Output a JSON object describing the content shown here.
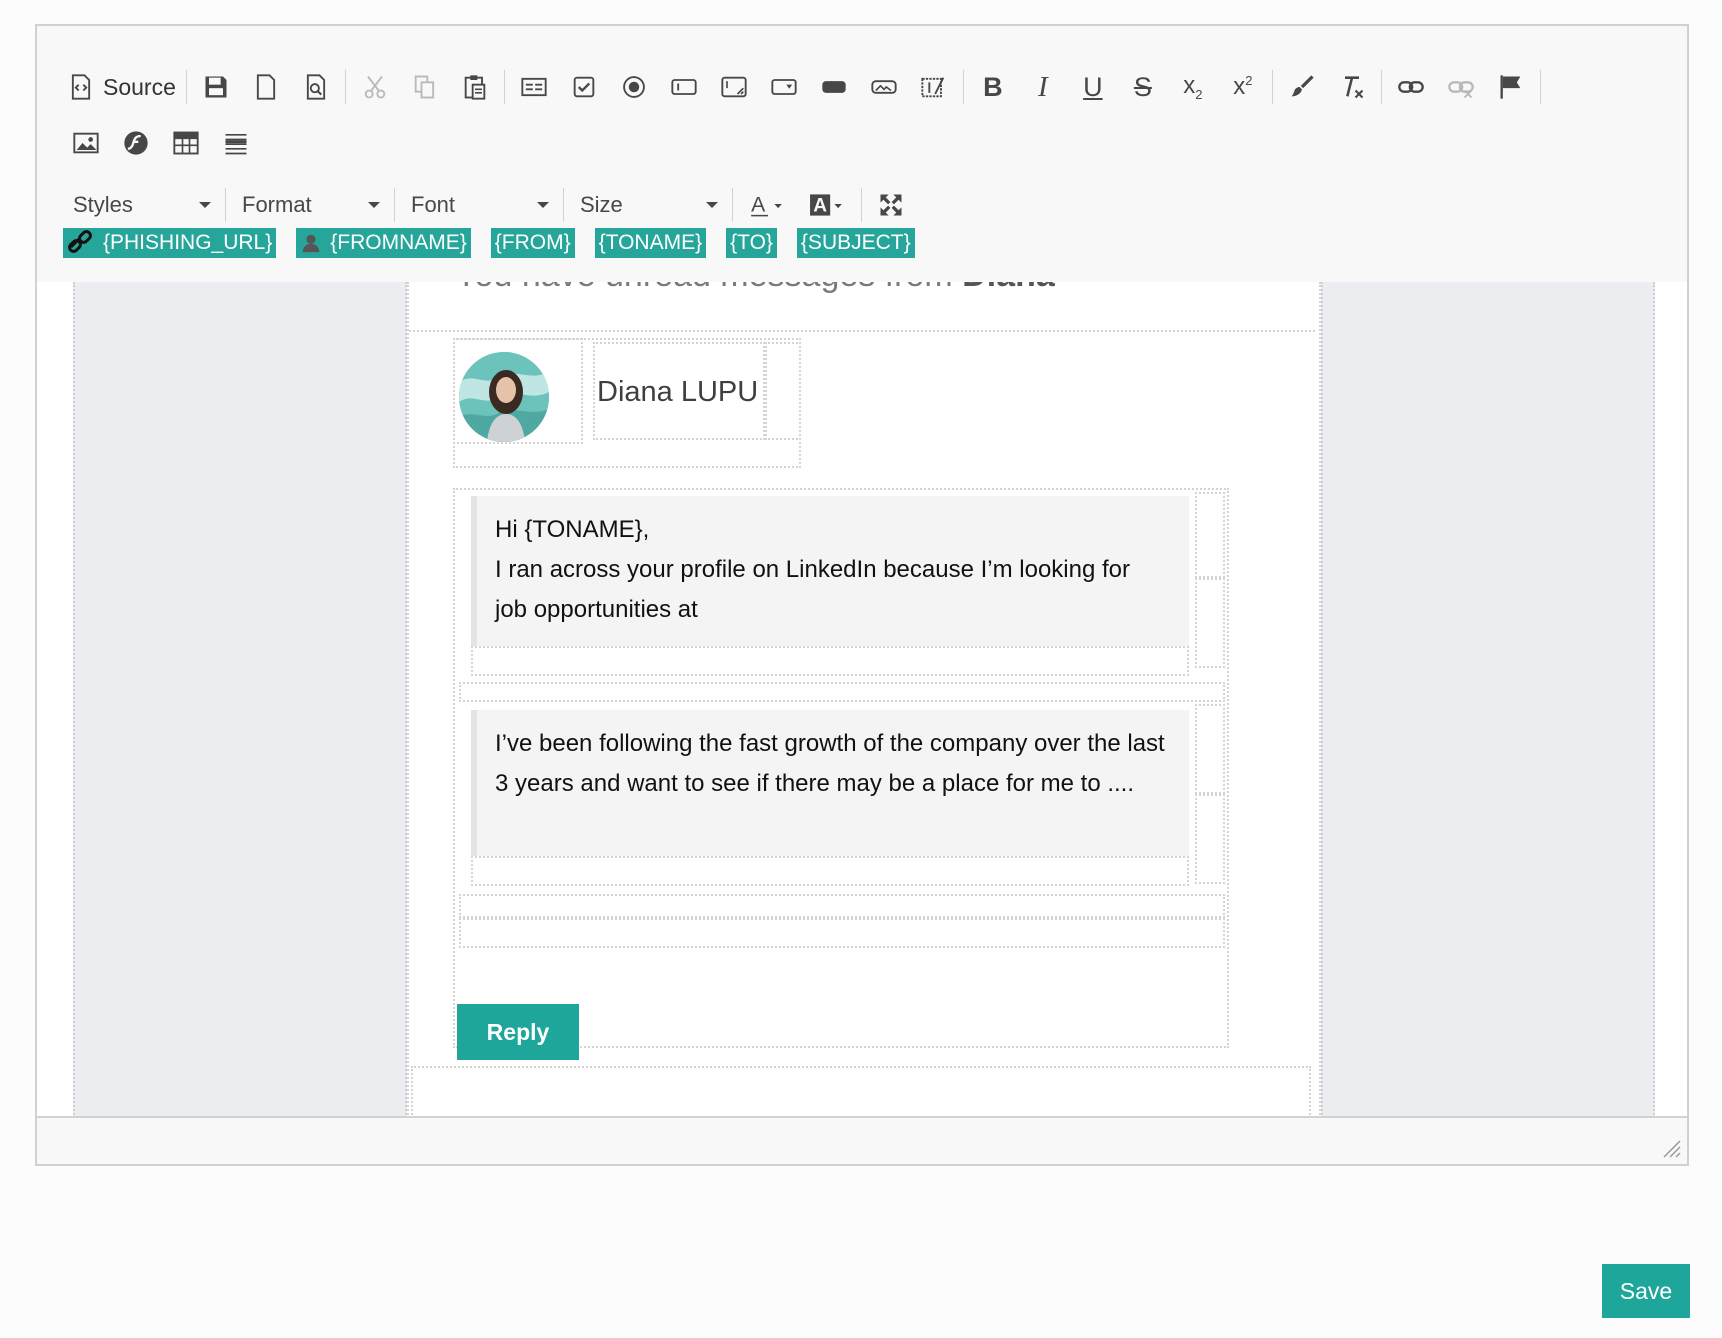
{
  "toolbar": {
    "source_label": "Source",
    "combos": {
      "styles": "Styles",
      "format": "Format",
      "font": "Font",
      "size": "Size"
    },
    "placeholders": {
      "phishing_url": "{PHISHING_URL}",
      "fromname": "{FROMNAME}",
      "from": "{FROM}",
      "toname": "{TONAME}",
      "to": "{TO}",
      "subject": "{SUBJECT}"
    }
  },
  "email": {
    "cut_heading_prefix": "You have unread messages from ",
    "cut_heading_name": "Diana",
    "sender_name": "Diana LUPU",
    "message1_line1": "Hi {TONAME},",
    "message1_line2": "I ran across your profile on LinkedIn because I’m looking for job opportunities at",
    "message2": "I’ve been following the fast growth of the company over the last 3 years and want to see if there may be a place for me to ....",
    "reply_label": "Reply"
  },
  "footer": {
    "save_label": "Save"
  },
  "colors": {
    "accent": "#26a69a",
    "button": "#1fa69b",
    "toolbar_bg": "#f8f8f8",
    "gutter_bg": "#ebedf0"
  }
}
